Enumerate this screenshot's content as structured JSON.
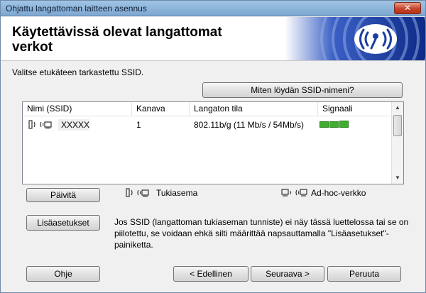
{
  "window": {
    "title": "Ohjattu langattoman laitteen asennus",
    "close_glyph": "✕"
  },
  "header": {
    "title": "Käytettävissä olevat langattomat verkot",
    "logo_icon": "wireless-signal-logo-icon"
  },
  "instruction": "Valitse etukäteen tarkastettu SSID.",
  "buttons": {
    "help_ssid": "Miten löydän SSID-nimeni?",
    "refresh": "Päivitä",
    "advanced": "Lisäasetukset",
    "help": "Ohje",
    "back": "< Edellinen",
    "next": "Seuraava >",
    "cancel": "Peruuta"
  },
  "table": {
    "columns": [
      "Nimi (SSID)",
      "Kanava",
      "Langaton tila",
      "Signaali"
    ],
    "rows": [
      {
        "ssid": "XXXXX",
        "channel": "1",
        "mode": "802.11b/g (11 Mb/s / 54Mb/s)",
        "icon": "access-point-icon",
        "signal_bars": 3
      }
    ]
  },
  "legend": {
    "access_point": "Tukiasema",
    "adhoc": "Ad-hoc-verkko"
  },
  "description": "Jos SSID (langattoman tukiaseman tunniste) ei näy tässä luettelossa tai se on piilotettu, se voidaan ehkä silti määrittää napsauttamalla \"Lisäasetukset\"-painiketta.",
  "colors": {
    "signal": "#3fae2e",
    "logo_blue": "#1b3fa0"
  }
}
